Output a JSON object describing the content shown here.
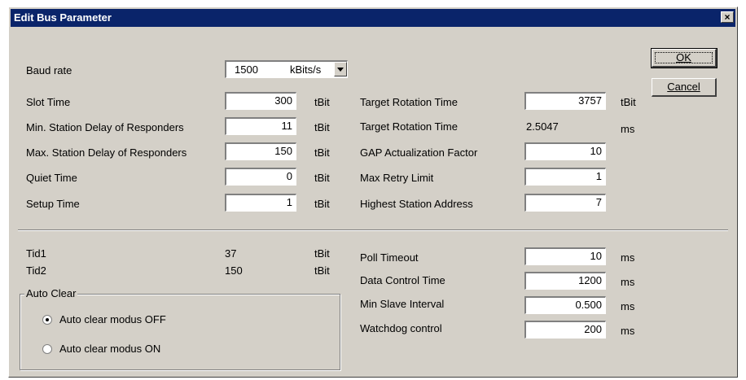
{
  "window": {
    "title": "Edit Bus Parameter",
    "close_glyph": "×"
  },
  "buttons": {
    "ok_label": "OK",
    "cancel_label": "Cancel"
  },
  "baud": {
    "label": "Baud rate",
    "value": "1500",
    "unit": "kBits/s"
  },
  "left_fields": [
    {
      "label": "Slot Time",
      "value": "300",
      "unit": "tBit"
    },
    {
      "label": "Min. Station Delay of Responders",
      "value": "11",
      "unit": "tBit"
    },
    {
      "label": "Max. Station Delay of Responders",
      "value": "150",
      "unit": "tBit"
    },
    {
      "label": "Quiet Time",
      "value": "0",
      "unit": "tBit"
    },
    {
      "label": "Setup Time",
      "value": "1",
      "unit": "tBit"
    }
  ],
  "right_fields": [
    {
      "label": "Target Rotation Time",
      "value": "3757",
      "unit": "tBit"
    },
    {
      "label": "Target Rotation Time",
      "value": "2.5047",
      "unit": "ms"
    },
    {
      "label": "GAP Actualization Factor",
      "value": "10",
      "unit": ""
    },
    {
      "label": "Max Retry Limit",
      "value": "1",
      "unit": ""
    },
    {
      "label": "Highest Station Address",
      "value": "7",
      "unit": ""
    }
  ],
  "tids": [
    {
      "label": "Tid1",
      "value": "37",
      "unit": "tBit"
    },
    {
      "label": "Tid2",
      "value": "150",
      "unit": "tBit"
    }
  ],
  "lower_right_fields": [
    {
      "label": "Poll Timeout",
      "value": "10",
      "unit": "ms"
    },
    {
      "label": "Data Control Time",
      "value": "1200",
      "unit": "ms"
    },
    {
      "label": "Min Slave Interval",
      "value": "0.500",
      "unit": "ms"
    },
    {
      "label": "Watchdog control",
      "value": "200",
      "unit": "ms"
    }
  ],
  "auto_clear": {
    "title": "Auto Clear",
    "options": [
      {
        "label": "Auto clear modus OFF",
        "checked": true
      },
      {
        "label": "Auto clear modus ON",
        "checked": false
      }
    ]
  }
}
